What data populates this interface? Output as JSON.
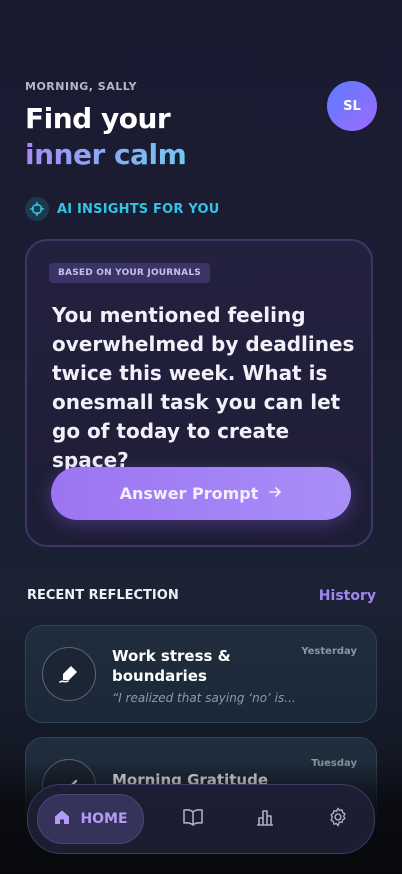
{
  "header": {
    "greeting": "MORNING, SALLY",
    "title_line1": "Find your",
    "title_line2": "inner calm",
    "avatar_initials": "SL"
  },
  "insights": {
    "section_label": "AI INSIGHTS FOR YOU",
    "chip": "BASED ON YOUR JOURNALS",
    "prompt": "You mentioned feeling overwhelmed by deadlines twice this week. What is onesmall task you can let go of today to create space?",
    "button_label": "Answer Prompt",
    "button_icon": "arrow-right-icon"
  },
  "recent": {
    "section_label": "RECENT REFLECTION",
    "history_label": "History",
    "entries": [
      {
        "title": "Work stress & boundaries",
        "excerpt": "“I realized that saying ‘no’ is...",
        "date": "Yesterday",
        "icon": "pen-eraser-icon"
      },
      {
        "title": "Morning Gratitude",
        "excerpt": "",
        "date": "Tuesday",
        "icon": "check-icon"
      }
    ]
  },
  "nav": {
    "home_label": "HOME",
    "items": [
      "home-icon",
      "book-icon",
      "chart-icon",
      "gear-icon"
    ]
  },
  "colors": {
    "accent_purple": "#a386f5",
    "accent_cyan": "#33c3e6",
    "button_gradient_start": "#9c74f3",
    "button_gradient_end": "#a98ef7"
  }
}
